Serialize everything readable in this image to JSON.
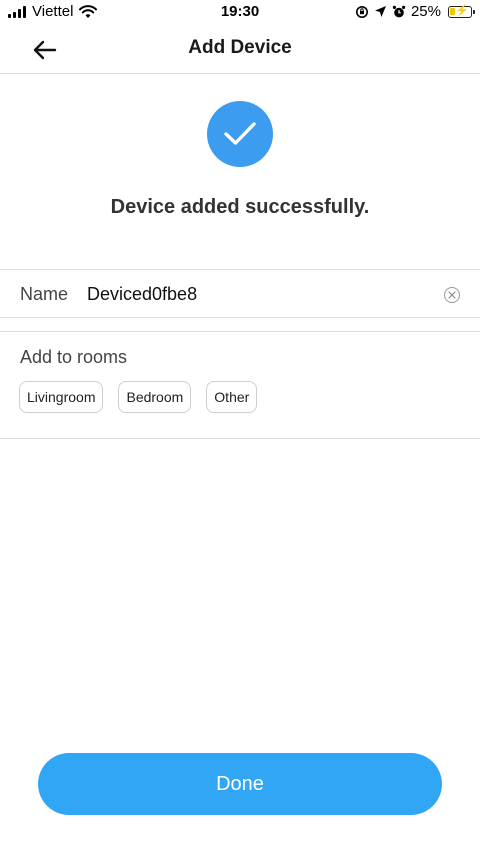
{
  "status_bar": {
    "carrier": "Viettel",
    "time": "19:30",
    "battery_percent": "25%",
    "battery_level": 0.25,
    "icons": [
      "signal-icon",
      "wifi-icon",
      "screen-lock-icon",
      "location-icon",
      "alarm-icon",
      "battery-charging-icon"
    ]
  },
  "header": {
    "title": "Add Device",
    "back_icon": "arrow-left-icon"
  },
  "success": {
    "icon": "checkmark-icon",
    "message": "Device added successfully."
  },
  "name_field": {
    "label": "Name",
    "value": "Deviced0fbe8",
    "clear_icon": "clear-icon"
  },
  "rooms": {
    "label": "Add to rooms",
    "options": [
      "Livingroom",
      "Bedroom",
      "Other"
    ]
  },
  "done_button": {
    "label": "Done"
  },
  "colors": {
    "accent": "#3b9cf0",
    "button": "#30a6f5",
    "divider": "#dcdcdc"
  }
}
